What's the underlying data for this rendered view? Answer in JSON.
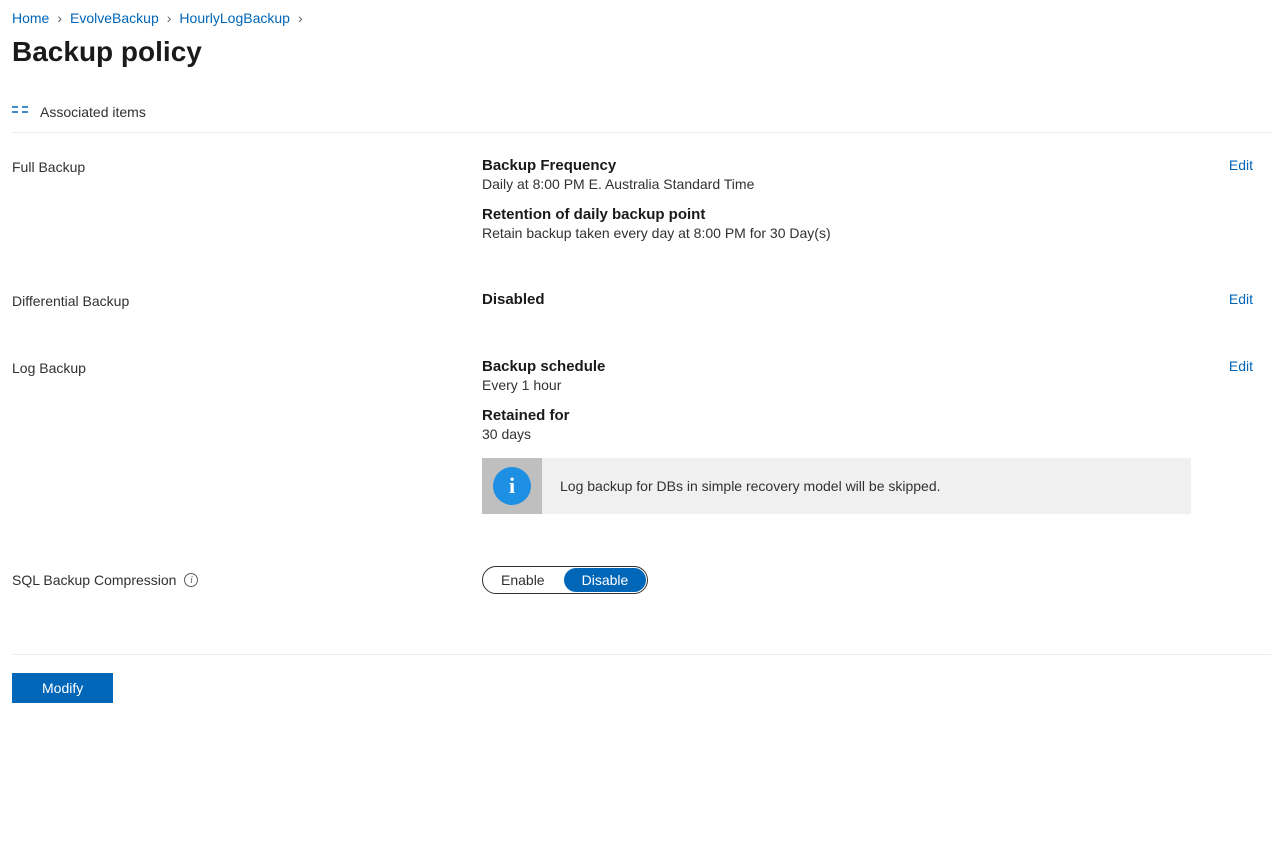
{
  "breadcrumb": {
    "home": "Home",
    "vault": "EvolveBackup",
    "policy": "HourlyLogBackup"
  },
  "page_title": "Backup policy",
  "toolbar": {
    "associated_items": "Associated items"
  },
  "full_backup": {
    "label": "Full Backup",
    "edit": "Edit",
    "freq_head": "Backup Frequency",
    "freq_val": "Daily at 8:00 PM E. Australia Standard Time",
    "ret_head": "Retention of daily backup point",
    "ret_val": "Retain backup taken every day at 8:00 PM for 30 Day(s)"
  },
  "diff_backup": {
    "label": "Differential Backup",
    "edit": "Edit",
    "status": "Disabled"
  },
  "log_backup": {
    "label": "Log Backup",
    "edit": "Edit",
    "sched_head": "Backup schedule",
    "sched_val": "Every 1 hour",
    "ret_head": "Retained for",
    "ret_val": "30 days",
    "info_text": "Log backup for DBs in simple recovery model will be skipped."
  },
  "compression": {
    "label": "SQL Backup Compression",
    "enable": "Enable",
    "disable": "Disable"
  },
  "footer": {
    "modify": "Modify"
  }
}
